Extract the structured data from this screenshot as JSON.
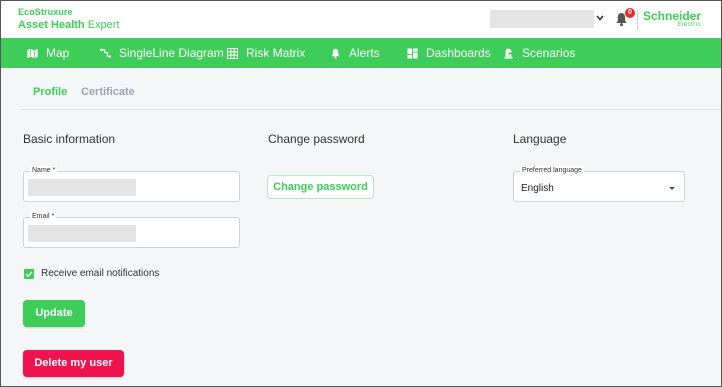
{
  "brand": {
    "ecostruxure": "EcoStruxure",
    "product_bold": "Asset Health",
    "product_light": "Expert"
  },
  "header": {
    "notification_count": "0",
    "logo_main": "Schneider",
    "logo_sub": "Electric"
  },
  "nav": {
    "items": [
      {
        "label": "Map",
        "icon": "map-icon"
      },
      {
        "label": "SingleLine Diagram",
        "icon": "singleline-icon"
      },
      {
        "label": "Risk Matrix",
        "icon": "grid-icon"
      },
      {
        "label": "Alerts",
        "icon": "bell-icon"
      },
      {
        "label": "Dashboards",
        "icon": "dashboard-icon"
      },
      {
        "label": "Scenarios",
        "icon": "chess-icon"
      }
    ]
  },
  "tabs": {
    "profile": "Profile",
    "certificate": "Certificate"
  },
  "basic_info": {
    "title": "Basic information",
    "name_label": "Name *",
    "email_label": "Email *",
    "notifications_label": "Receive email notifications",
    "notifications_checked": true,
    "update_button": "Update",
    "delete_button": "Delete my user"
  },
  "password": {
    "title": "Change password",
    "button": "Change password"
  },
  "language": {
    "title": "Language",
    "field_label": "Preferred language",
    "selected": "English"
  },
  "colors": {
    "brand_green": "#3dcd58",
    "danger": "#f0134d",
    "badge_red": "#e32b2b"
  }
}
